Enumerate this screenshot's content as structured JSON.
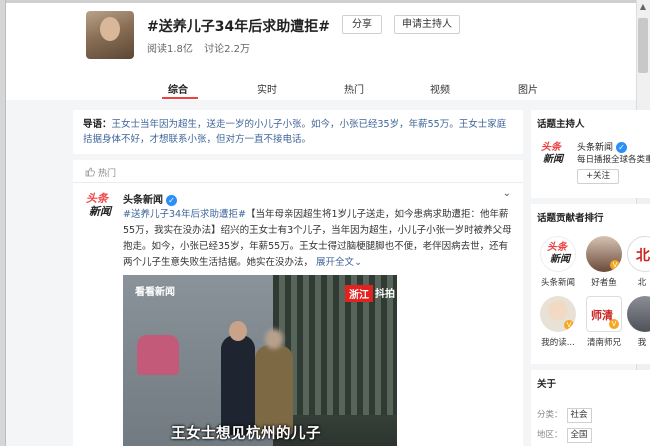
{
  "header": {
    "topic_title": "#送养儿子34年后求助遭拒#",
    "share_label": "分享",
    "apply_label": "申请主持人",
    "reads": "阅读1.8亿",
    "discussions": "讨论2.2万"
  },
  "tabs": [
    {
      "label": "综合"
    },
    {
      "label": "实时"
    },
    {
      "label": "热门"
    },
    {
      "label": "视频"
    },
    {
      "label": "图片"
    }
  ],
  "intro": {
    "lead": "导语：",
    "text": "王女士当年因为超生，送走一岁的小儿子小张。如今，小张已经35岁，年薪55万。王女士家庭拮据身体不好，才想联系小张，但对方一直不接电话。"
  },
  "feed": {
    "hot_label": "热门",
    "post": {
      "logo_line1": "头条",
      "logo_line2": "新闻",
      "author": "头条新闻",
      "more": "⌄",
      "hashtag": "#送养儿子34年后求助遭拒#",
      "body1": "【当年母亲因超生将1岁儿子送走，如今患病求助遭拒：他年薪55万，我实在没办法】绍兴的王女士有3个儿子，当年因为超生，小儿子小张一岁时被养父母抱走。如今，小张已经35岁，年薪55万。王女士得过脑梗腿脚也不便，老伴因病去世，还有两个儿子生意失败生活拮据。她实在没办法，",
      "expand": "展开全文",
      "expand_arrow": "⌄",
      "video_logo": "看看新闻",
      "video_tag": "浙江",
      "video_tag2": "抖拍",
      "video_caption": "王女士想见杭州的儿子"
    }
  },
  "sidebar": {
    "host_title": "话题主持人",
    "host": {
      "logo_line1": "头条",
      "logo_line2": "新闻",
      "name": "头条新闻",
      "desc": "每日播报全球各类重",
      "follow": "+关注"
    },
    "rank_title": "话题贡献者排行",
    "rank": [
      {
        "name": "头条新闻"
      },
      {
        "name": "好者鱼"
      },
      {
        "name": "北"
      },
      {
        "name": "我的读..."
      },
      {
        "name": "清南师兄"
      },
      {
        "name": "我"
      }
    ],
    "about_title": "关于",
    "about": {
      "category_label": "分类：",
      "category": "社会",
      "region_label": "地区：",
      "region": "全国"
    }
  },
  "colors": {
    "accent_red": "#f04142",
    "link_blue": "#406599",
    "verified_blue": "#2a8ff7"
  }
}
